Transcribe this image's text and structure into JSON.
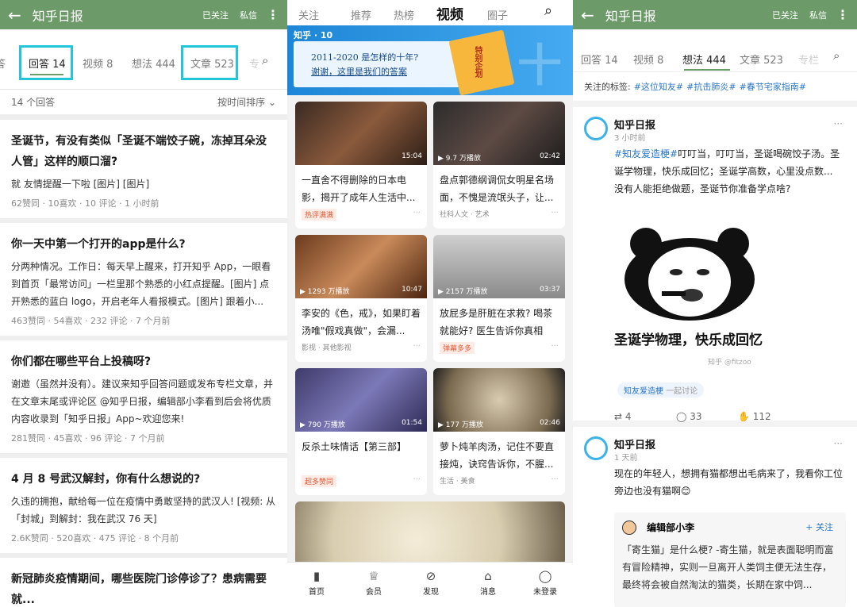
{
  "left": {
    "header": {
      "title": "知乎日报",
      "follow": "已关注",
      "message": "私信"
    },
    "tabs": [
      "答",
      "回答 14",
      "视频 8",
      "想法 444",
      "文章 523",
      "专"
    ],
    "count": "14 个回答",
    "sort": "按时间排序",
    "items": [
      {
        "q": "圣诞节，有没有类似「圣诞不端饺子碗，冻掉耳朵没人管」这样的顺口溜?",
        "a": "就 友情提醒一下啦 [图片] [图片]",
        "m": "62赞同 · 10喜欢 · 10 评论 · 1 小时前"
      },
      {
        "q": "你一天中第一个打开的app是什么?",
        "a": "分两种情况。工作日：每天早上醒来，打开知乎 App，一眼看到首页「最常访问」一栏里那个熟悉的小红点提醒。[图片] 点开熟悉的蓝白 logo，开启老年人看报模式。[图片] 跟着小...",
        "m": "463赞同 · 54喜欢 · 232 评论 · 7 个月前"
      },
      {
        "q": "你们都在哪些平台上投稿呀?",
        "a": "谢邀（虽然并没有）。建议来知乎回答问题或发布专栏文章，并在文章末尾或评论区 @知乎日报，编辑部小李看到后会将优质内容收录到「知乎日报」App~欢迎您来!",
        "m": "281赞同 · 45喜欢 · 96 评论 · 7 个月前"
      },
      {
        "q": "4 月 8 号武汉解封，你有什么想说的?",
        "a": "久违的拥抱，献给每一位在疫情中勇敢坚持的武汉人! [视频: 从「封城」到解封：我在武汉 76 天]",
        "m": "2.6K赞同 · 520喜欢 · 475 评论 · 8 个月前"
      },
      {
        "q": "新冠肺炎疫情期间，哪些医院门诊停诊了？患病需要就...",
        "a": "",
        "m": ""
      }
    ]
  },
  "middle": {
    "tabs": [
      "关注",
      "推荐",
      "热榜",
      "视频",
      "圈子"
    ],
    "banner": {
      "logo": "知乎 · 10",
      "line1": "2011-2020 是怎样的十年?",
      "line2": "谢谢，这里是我们的答案",
      "book": "特别企划"
    },
    "videos": [
      {
        "plays": "793 万播放",
        "dur": "15:04",
        "title": "一直舍不得删除的日本电影，揭开了成年人生活中...",
        "tag": "热评满满",
        "tagred": true
      },
      {
        "plays": "9.7 万播放",
        "dur": "02:42",
        "title": "盘点郭德纲调侃女明星名场面，不愧是流氓头子，让...",
        "tag": "社科人文 · 艺术",
        "tagred": false
      },
      {
        "plays": "1293 万播放",
        "dur": "10:47",
        "title": "李安的《色，戒》，如果盯着汤唯\"假戏真做\"，会漏...",
        "tag": "影视 · 其他影视",
        "tagred": false
      },
      {
        "plays": "2157 万播放",
        "dur": "03:37",
        "title": "放屁多是肝脏在求救? 喝茶就能好? 医生告诉你真相",
        "tag": "弹幕多多",
        "tagred": true
      },
      {
        "plays": "790 万播放",
        "dur": "01:54",
        "title": "反杀土味情话【第三部】",
        "tag": "超多赞同",
        "tagred": true
      },
      {
        "plays": "177 万播放",
        "dur": "02:46",
        "title": "萝卜炖羊肉汤，记住不要直接炖，诀窍告诉你，不腥...",
        "tag": "生活 · 美食",
        "tagred": false
      }
    ],
    "nav": [
      "首页",
      "会员",
      "发现",
      "消息",
      "未登录"
    ],
    "colors": {
      "accent": "#1a73d9"
    }
  },
  "right": {
    "header": {
      "title": "知乎日报",
      "follow": "已关注",
      "message": "私信"
    },
    "tabs": [
      "回答 14",
      "视频 8",
      "想法 444",
      "文章 523",
      "专栏"
    ],
    "tags_label": "关注的标签:",
    "tags": [
      "#这位知友#",
      "#抗击肺炎#",
      "#春节宅家指南#"
    ],
    "post1": {
      "name": "知乎日报",
      "time": "3 小时前",
      "topic": "#知友爱造梗#",
      "text1": "叮叮当，叮叮当，圣诞喝碗饺子汤。圣诞学物理，快乐成回忆；圣诞学高数，心里没点数...",
      "text2": "没有人能拒绝做题，圣诞节你准备学点啥?",
      "meme": "圣诞学物理，快乐成回忆",
      "watermark": "知乎 @fitzoo",
      "pill": "知友爱造梗",
      "pill2": "一起讨论",
      "repost": "4",
      "comments": "33",
      "likes": "112"
    },
    "post2": {
      "name": "知乎日报",
      "time": "1 天前",
      "text": "现在的年轻人，想拥有猫都想出毛病来了，我看你工位旁边也没有猫啊😊",
      "quote_name": "编辑部小李",
      "follow": "+ 关注",
      "quote": "「寄生猫」是什么梗? -寄生猫，就是表面聪明而富有冒险精神，实则一旦离开人类饲主便无法生存，最终将会被自然淘汰的猫类，长期在家中饲..."
    }
  }
}
